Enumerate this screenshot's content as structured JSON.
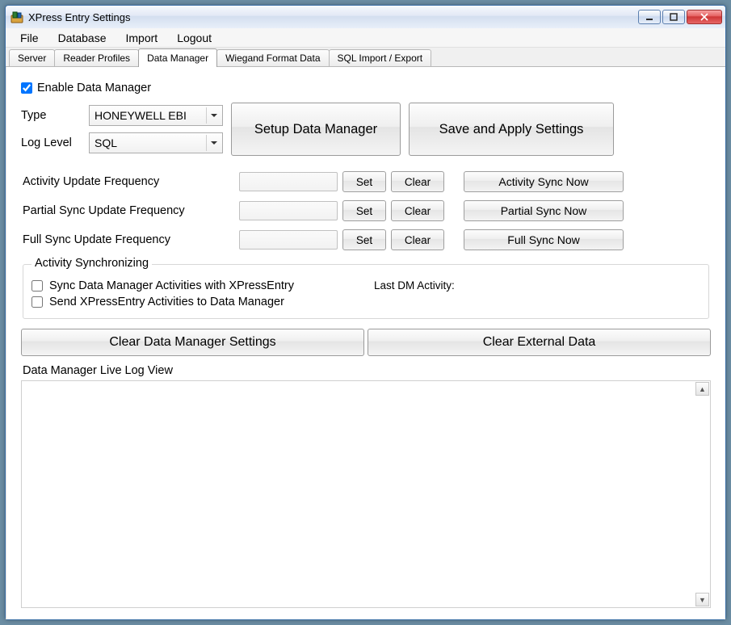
{
  "window": {
    "title": "XPress Entry Settings"
  },
  "menu": {
    "file": "File",
    "database": "Database",
    "import": "Import",
    "logout": "Logout"
  },
  "tabs": {
    "server": "Server",
    "reader_profiles": "Reader Profiles",
    "data_manager": "Data Manager",
    "wiegand": "Wiegand Format Data",
    "sql": "SQL Import / Export"
  },
  "dm": {
    "enable_label": "Enable Data Manager",
    "enable_checked": true,
    "type_label": "Type",
    "type_value": "HONEYWELL EBI",
    "loglevel_label": "Log Level",
    "loglevel_value": "SQL",
    "setup_btn": "Setup Data Manager",
    "save_btn": "Save and Apply Settings",
    "freq": {
      "activity_label": "Activity Update Frequency",
      "partial_label": "Partial Sync Update Frequency",
      "full_label": "Full Sync Update Frequency",
      "set_label": "Set",
      "clear_label": "Clear",
      "activity_now": "Activity Sync Now",
      "partial_now": "Partial Sync Now",
      "full_now": "Full Sync Now",
      "activity_value": "",
      "partial_value": "",
      "full_value": ""
    },
    "sync": {
      "legend": "Activity Synchronizing",
      "sync_with_xe_label": "Sync Data Manager Activities with XPressEntry",
      "sync_with_xe_checked": false,
      "send_to_dm_label": "Send XPressEntry Activities to Data Manager",
      "send_to_dm_checked": false,
      "last_activity_label": "Last DM Activity:",
      "last_activity_value": ""
    },
    "clear_settings_btn": "Clear Data Manager Settings",
    "clear_external_btn": "Clear External Data",
    "log_label": "Data Manager Live Log View"
  }
}
